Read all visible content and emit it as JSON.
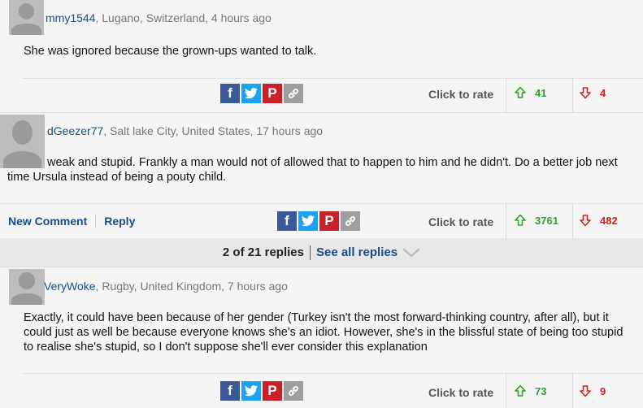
{
  "comments": [
    {
      "username": "mmy1544",
      "location": ", Lugano, Switzerland, 4 hours ago",
      "text": "She was ignored because the grown-ups wanted to talk.",
      "rate_label": "Click to rate",
      "up": "41",
      "down": "4"
    },
    {
      "username": "dGeezer77",
      "location": ", Salt lake City, United States, 17 hours ago",
      "text": "weak and stupid. Frankly a man would not of allowed that to happen to him and he didn't. Do a better job next time Ursula instead of being a pouty child.",
      "new_comment": "New Comment",
      "reply": "Reply",
      "rate_label": "Click to rate",
      "up": "3761",
      "down": "482"
    },
    {
      "username": "VeryWoke",
      "location": ", Rugby, United Kingdom, 7 hours ago",
      "text": "Exactly, it could have been because of her gender (Turkey isn't the most forward-thinking country, after all), but it could just as well be because everyone knows she's an idiot. However, she's in the blissful state of being too stupid to realise she's stupid, so I don't suppose she'll ever consider this explanation",
      "rate_label": "Click to rate",
      "up": "73",
      "down": "9"
    }
  ],
  "replies": {
    "count": "2 of 21 replies",
    "see_all": "See all replies"
  },
  "share": {
    "facebook": "f",
    "pinterest": "P"
  },
  "icons": [
    "facebook-icon",
    "twitter-icon",
    "pinterest-icon",
    "link-icon",
    "arrow-up-icon",
    "arrow-down-icon",
    "chevron-down-icon",
    "avatar"
  ],
  "colors": {
    "upvote": "#2e9e2e",
    "downvote": "#d42020",
    "link": "#1a4c8a",
    "facebook": "#3b5998",
    "twitter": "#1da1f2",
    "pinterest": "#cb2027"
  }
}
